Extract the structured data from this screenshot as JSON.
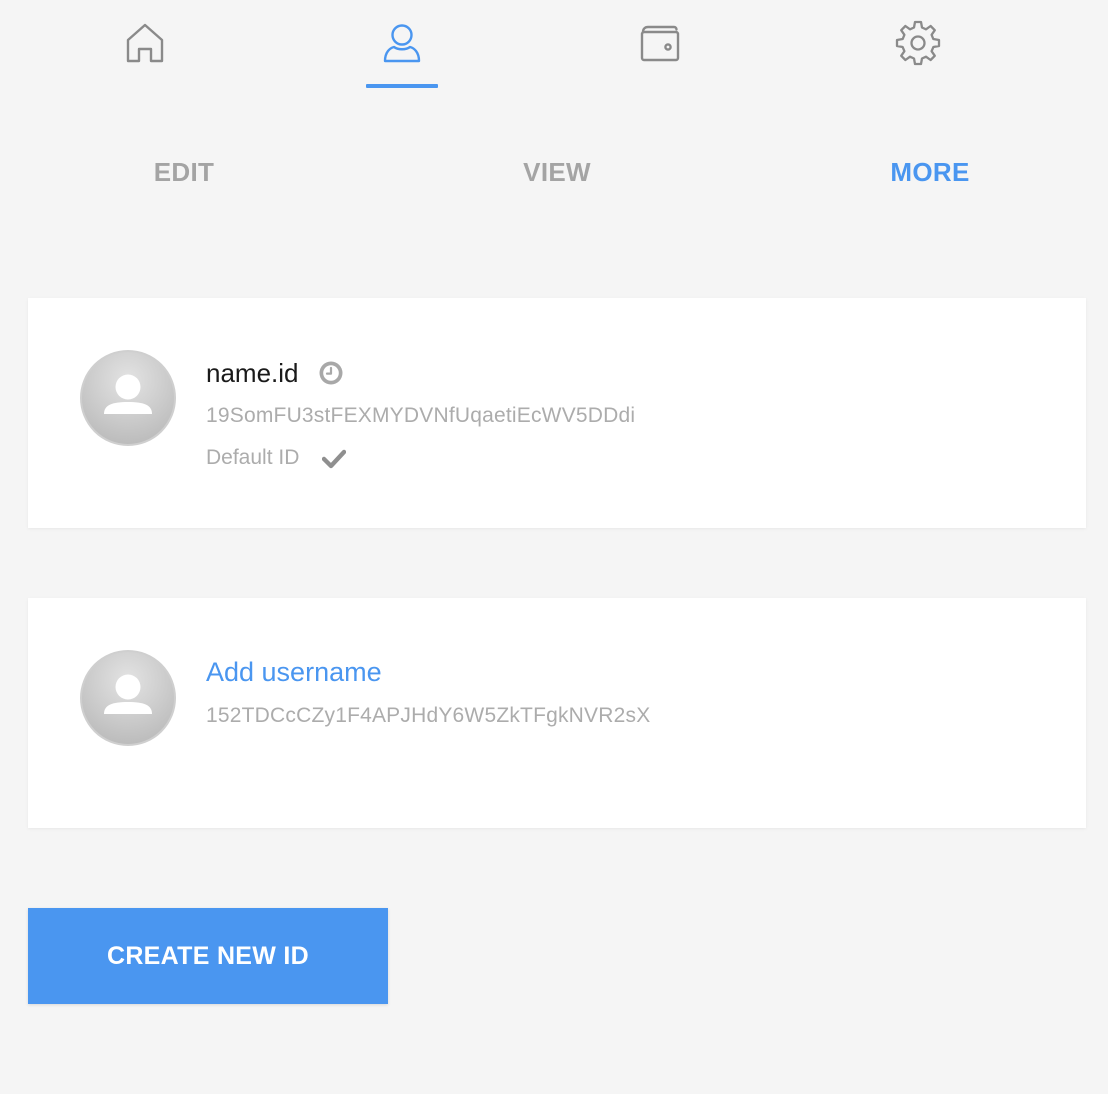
{
  "nav": {
    "items": [
      {
        "icon": "home-icon",
        "active": false
      },
      {
        "icon": "user-icon",
        "active": true
      },
      {
        "icon": "wallet-icon",
        "active": false
      },
      {
        "icon": "gear-icon",
        "active": false
      }
    ],
    "active_color": "#4a96f0",
    "inactive_color": "#8a8a8a"
  },
  "subtabs": {
    "edit": "EDIT",
    "view": "VIEW",
    "more": "MORE",
    "active": "MORE"
  },
  "ids": [
    {
      "name": "name.id",
      "address": "19SomFU3stFEXMYDVNfUqaetiEcWV5DDdi",
      "default_label": "Default ID",
      "status_icon": "clock-icon"
    },
    {
      "add_username_label": "Add username",
      "address": "152TDCcCZy1F4APJHdY6W5ZkTFgkNVR2sX"
    }
  ],
  "create_button": {
    "label": "CREATE NEW ID",
    "color": "#4a96f0"
  }
}
